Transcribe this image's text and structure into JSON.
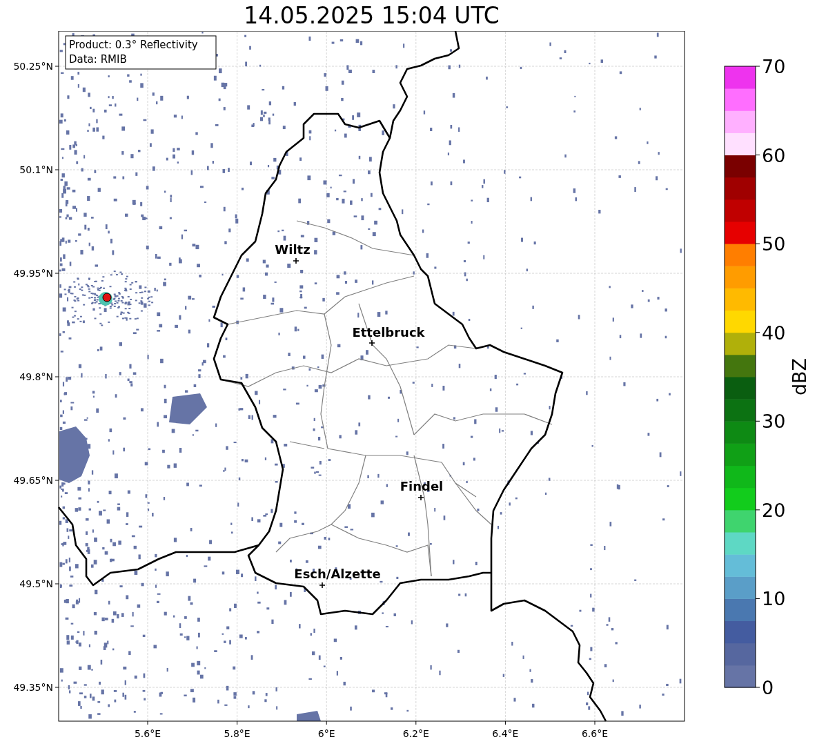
{
  "title": "14.05.2025 15:04 UTC",
  "info_box": {
    "lines": [
      "Product: 0.3° Reflectivity",
      "Data: RMIB"
    ]
  },
  "map": {
    "yticks": [
      "50.25°N",
      "50.1°N",
      "49.95°N",
      "49.8°N",
      "49.65°N",
      "49.5°N",
      "49.35°N"
    ],
    "xticks": [
      "5.6°E",
      "5.8°E",
      "6°E",
      "6.2°E",
      "6.4°E",
      "6.6°E"
    ],
    "cities": [
      {
        "name": "Wiltz"
      },
      {
        "name": "Ettelbruck"
      },
      {
        "name": "Findel"
      },
      {
        "name": "Esch/Alzette"
      }
    ]
  },
  "colorbar": {
    "label": "dBZ",
    "ticks": [
      "70",
      "60",
      "50",
      "40",
      "30",
      "20",
      "10",
      "0"
    ],
    "bins": [
      {
        "color": "#6674a6"
      },
      {
        "color": "#56679f"
      },
      {
        "color": "#445ca0"
      },
      {
        "color": "#4a78b0"
      },
      {
        "color": "#5a9ec8"
      },
      {
        "color": "#64bdd8"
      },
      {
        "color": "#5ed8c4"
      },
      {
        "color": "#3fd46e"
      },
      {
        "color": "#12cc1c"
      },
      {
        "color": "#10b81a"
      },
      {
        "color": "#10a016"
      },
      {
        "color": "#0e8a14"
      },
      {
        "color": "#0c7212"
      },
      {
        "color": "#0a5e10"
      },
      {
        "color": "#44760e"
      },
      {
        "color": "#b0b00a"
      },
      {
        "color": "#ffd800"
      },
      {
        "color": "#ffba00"
      },
      {
        "color": "#ff9c00"
      },
      {
        "color": "#ff7e00"
      },
      {
        "color": "#e60000"
      },
      {
        "color": "#c00000"
      },
      {
        "color": "#a00000"
      },
      {
        "color": "#7a0000"
      },
      {
        "color": "#ffe0ff"
      },
      {
        "color": "#ffb0ff"
      },
      {
        "color": "#ff6eff"
      },
      {
        "color": "#ee33ee"
      }
    ]
  }
}
